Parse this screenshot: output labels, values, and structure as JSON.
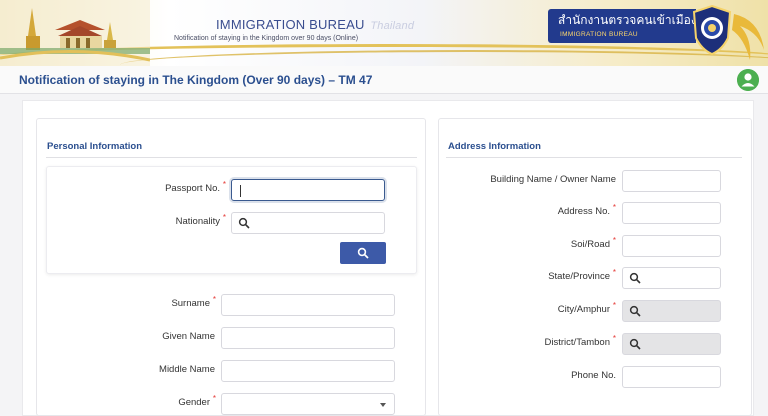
{
  "header": {
    "bureau_title": "IMMIGRATION BUREAU",
    "bureau_title_suffix": "Thailand",
    "bureau_subtitle": "Notification of staying in the Kingdom over 90 days (Online)",
    "thai_name": "สำนักงานตรวจคนเข้าเมือง",
    "thai_name_en": "IMMIGRATION BUREAU"
  },
  "titlebar": {
    "page_title": "Notification of staying in The Kingdom (Over 90 days) – TM 47"
  },
  "personal": {
    "section_title": "Personal Information",
    "passport_label": "Passport No.",
    "passport_value": "",
    "nationality_label": "Nationality",
    "nationality_value": "",
    "surname_label": "Surname",
    "given_name_label": "Given Name",
    "middle_name_label": "Middle Name",
    "gender_label": "Gender",
    "gender_value": ""
  },
  "address": {
    "section_title": "Address Information",
    "building_label": "Building Name / Owner Name",
    "address_no_label": "Address No.",
    "soi_label": "Soi/Road",
    "state_label": "State/Province",
    "city_label": "City/Amphur",
    "district_label": "District/Tambon",
    "phone_label": "Phone No."
  },
  "required_mark": "*",
  "colors": {
    "accent": "#3d5aa8",
    "title_blue": "#2b4f8f",
    "required_red": "#e53935",
    "user_green": "#4caf50",
    "thai_box": "#223a8d"
  },
  "icons": {
    "search": "magnifier-icon",
    "user": "user-circle-icon",
    "dropdown": "chevron-down-icon"
  }
}
